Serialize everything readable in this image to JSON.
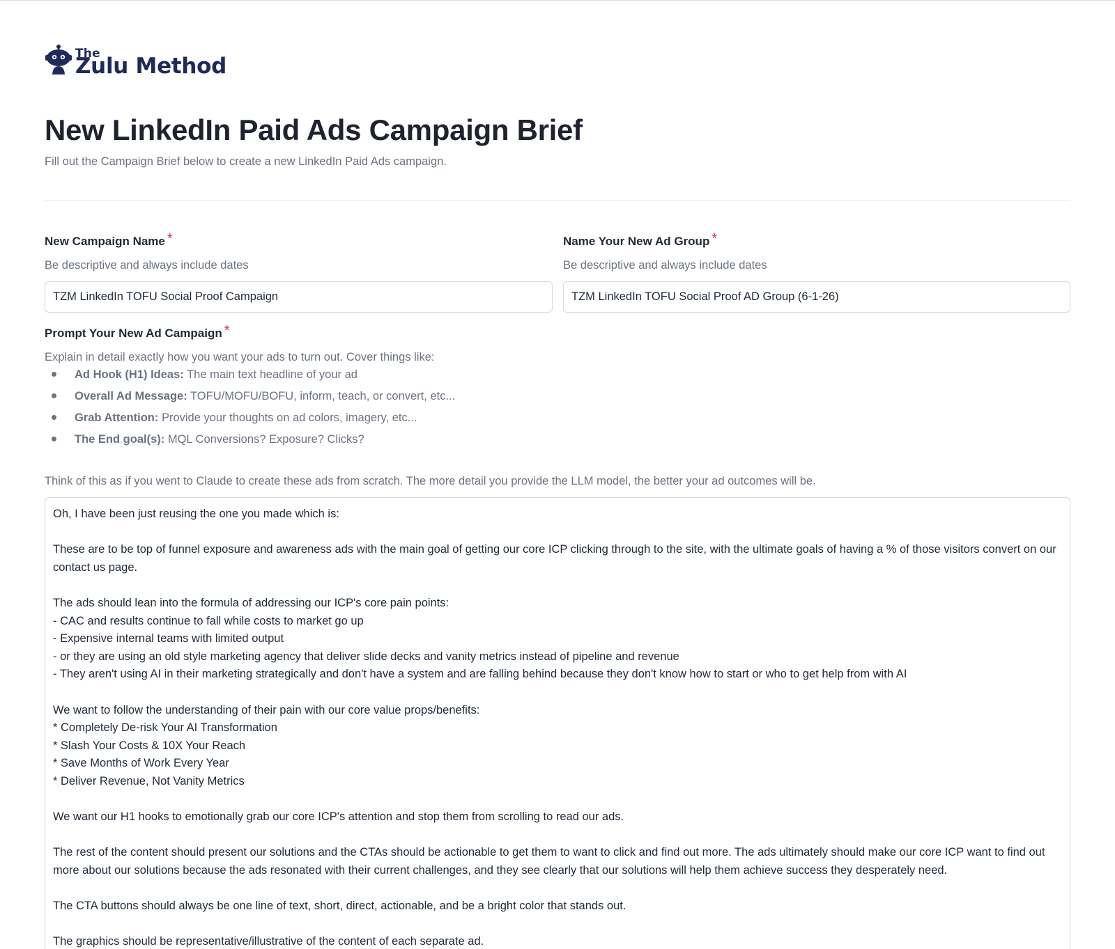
{
  "brand": {
    "logo_small": "The",
    "logo_large": "Zulu Method",
    "color": "#1e2a5a"
  },
  "page": {
    "title": "New LinkedIn Paid Ads Campaign Brief",
    "subtitle": "Fill out the Campaign Brief below to create a new LinkedIn Paid Ads campaign."
  },
  "fields": {
    "campaign_name": {
      "label": "New Campaign Name",
      "required_mark": "*",
      "help": "Be descriptive and always include dates",
      "value": "TZM LinkedIn TOFU Social Proof Campaign"
    },
    "ad_group": {
      "label": "Name Your New Ad Group",
      "required_mark": "*",
      "help": "Be descriptive and always include dates",
      "value": "TZM LinkedIn TOFU Social Proof AD Group (6-1-26)"
    },
    "prompt": {
      "label": "Prompt Your New Ad Campaign",
      "required_mark": "*",
      "help_intro": "Explain in detail exactly how you want your ads to turn out. Cover things like:",
      "bullets": [
        {
          "term": "Ad Hook (H1) Ideas:",
          "desc": " The main text headline of your ad"
        },
        {
          "term": "Overall Ad Message:",
          "desc": " TOFU/MOFU/BOFU, inform, teach, or convert, etc..."
        },
        {
          "term": "Grab Attention:",
          "desc": " Provide your thoughts on ad colors, imagery, etc..."
        },
        {
          "term": "The End goal(s):",
          "desc": " MQL Conversions? Exposure? Clicks?"
        }
      ],
      "help_outro": "Think of this as if you went to Claude to create these ads from scratch. The more detail you provide the LLM model, the better your ad outcomes will be.",
      "value": "Oh, I have been just reusing the one you made which is:\n\nThese are to be top of funnel exposure and awareness ads with the main goal of getting our core ICP clicking through to the site, with the ultimate goals of having a % of those visitors convert on our contact us page.\n\nThe ads should lean into the formula of addressing our ICP's core pain points:\n- CAC and results continue to fall while costs to market go up\n- Expensive internal teams with limited output\n- or they are using an old style marketing agency that deliver slide decks and vanity metrics instead of pipeline and revenue\n- They aren't using AI in their marketing strategically and don't have a system and are falling behind because they don't know how to start or who to get help from with AI\n\nWe want to follow the understanding of their pain with our core value props/benefits:\n* Completely De-risk Your AI Transformation\n* Slash Your Costs & 10X Your Reach\n* Save Months of Work Every Year\n* Deliver Revenue, Not Vanity Metrics\n\nWe want our H1 hooks to emotionally grab our core ICP's attention and stop them from scrolling to read our ads.\n\nThe rest of the content should present our solutions and the CTAs should be actionable to get them to want to click and find out more. The ads ultimately should make our core ICP want to find out more about our solutions because the ads resonated with their current challenges, and they see clearly that our solutions will help them achieve success they desperately need.\n\nThe CTA buttons should always be one line of text, short, direct, actionable, and be a bright color that stands out.\n\nThe graphics should be representative/illustrative of the content of each separate ad."
    }
  },
  "colors": {
    "required": "#d1334a",
    "muted_text": "#6b7280",
    "border": "#d5d9e0"
  }
}
